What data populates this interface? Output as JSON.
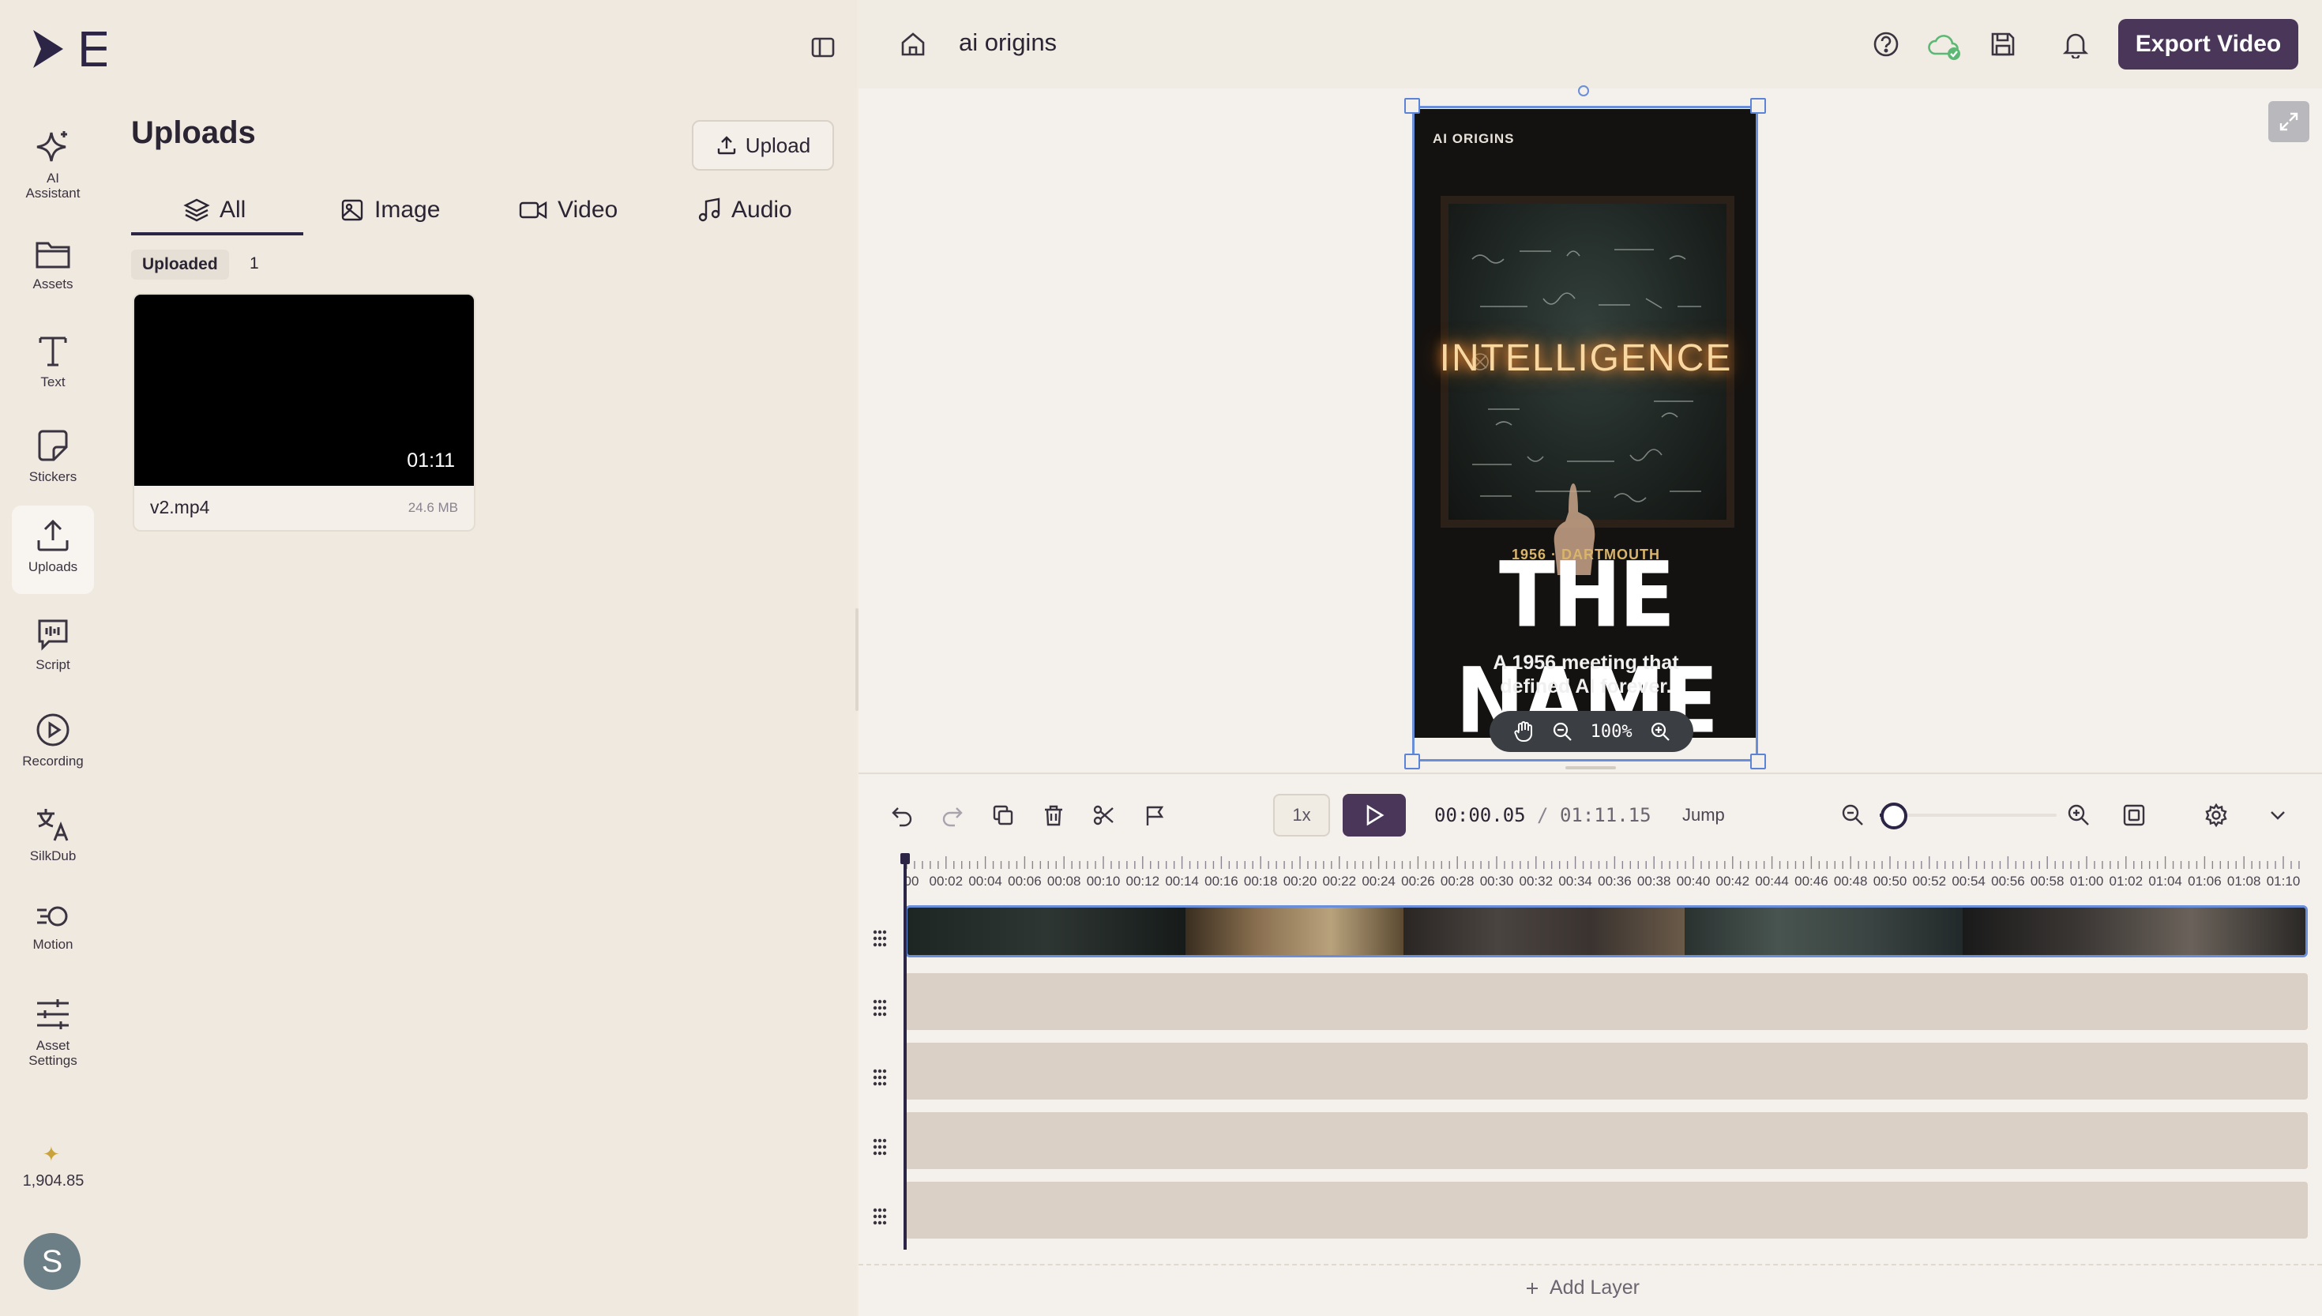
{
  "app": {
    "name": "Ekly"
  },
  "rail": {
    "items": [
      {
        "id": "ai",
        "label": "AI\nAssistant",
        "icon": "sparkle-icon"
      },
      {
        "id": "assets",
        "label": "Assets",
        "icon": "folder-icon"
      },
      {
        "id": "text",
        "label": "Text",
        "icon": "text-icon"
      },
      {
        "id": "stickers",
        "label": "Stickers",
        "icon": "sticker-icon"
      },
      {
        "id": "uploads",
        "label": "Uploads",
        "icon": "upload-icon",
        "active": true
      },
      {
        "id": "script",
        "label": "Script",
        "icon": "script-icon"
      },
      {
        "id": "recording",
        "label": "Recording",
        "icon": "play-circle-icon"
      },
      {
        "id": "silkdub",
        "label": "SilkDub",
        "icon": "translate-icon"
      },
      {
        "id": "motion",
        "label": "Motion",
        "icon": "motion-icon"
      },
      {
        "id": "asset-settings",
        "label": "Asset\nSettings",
        "icon": "sliders-icon"
      }
    ],
    "credits": "1,904.85",
    "avatar_initial": "S"
  },
  "panel": {
    "title": "Uploads",
    "upload_button": "Upload",
    "tabs": [
      {
        "label": "All",
        "icon": "layers-icon",
        "active": true
      },
      {
        "label": "Image",
        "icon": "image-icon"
      },
      {
        "label": "Video",
        "icon": "video-icon"
      },
      {
        "label": "Audio",
        "icon": "music-icon"
      }
    ],
    "section_label": "Uploaded",
    "section_count": "1",
    "files": [
      {
        "name": "v2.mp4",
        "size": "24.6 MB",
        "duration": "01:11"
      }
    ]
  },
  "header": {
    "project_title": "ai origins",
    "export_label": "Export Video"
  },
  "preview": {
    "brand": "AI ORIGINS",
    "glow_word": "INTELLIGENCE",
    "subtitle": "1956 · DARTMOUTH",
    "headline": "THE NAME",
    "description": "A 1956 meeting that defined AI forever.",
    "zoom": "100%"
  },
  "timeline": {
    "speed": "1x",
    "current_time": "00:00.05",
    "separator": "/",
    "total_time": "01:11.15",
    "jump_label": "Jump",
    "zoom_level": 0.05,
    "ruler_labels": [
      "00",
      "00:02",
      "00:04",
      "00:06",
      "00:08",
      "00:10",
      "00:12",
      "00:14",
      "00:16",
      "00:18",
      "00:20",
      "00:22",
      "00:24",
      "00:26",
      "00:28",
      "00:30",
      "00:32",
      "00:34",
      "00:36",
      "00:38",
      "00:40",
      "00:42",
      "00:44",
      "00:46",
      "00:48",
      "00:50",
      "00:52",
      "00:54",
      "00:56",
      "00:58",
      "01:00",
      "01:02",
      "01:04",
      "01:06",
      "01:08",
      "01:10"
    ],
    "add_layer": "Add Layer"
  },
  "colors": {
    "accent": "#4a3658",
    "selection": "#6a8fd8",
    "background": "#f0ebe3"
  }
}
